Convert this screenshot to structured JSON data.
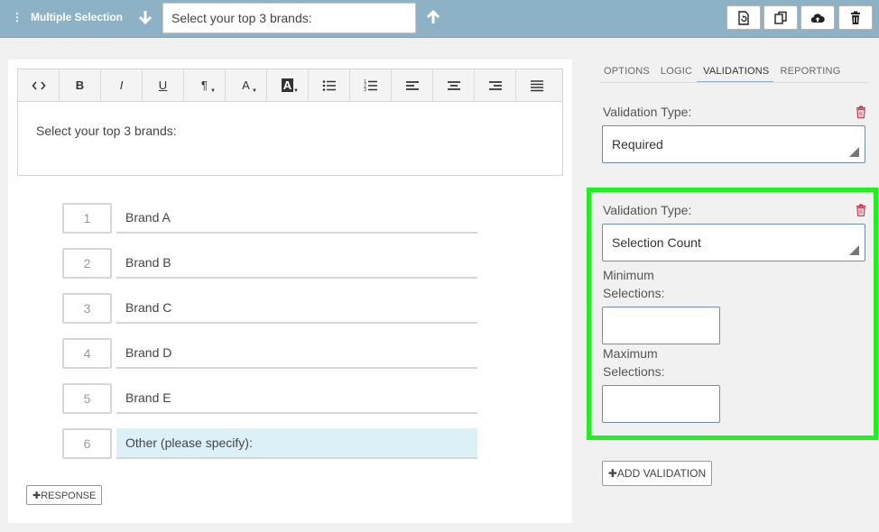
{
  "header": {
    "question_type": "Multiple Selection",
    "question_text": "Select your top 3 brands:",
    "tools": [
      "page-refresh-icon",
      "copy-icon",
      "cloud-upload-icon",
      "trash-icon"
    ]
  },
  "editor": {
    "toolbar": [
      {
        "name": "code",
        "label": "<>"
      },
      {
        "name": "bold",
        "label": "B"
      },
      {
        "name": "italic",
        "label": "I"
      },
      {
        "name": "underline",
        "label": "U"
      },
      {
        "name": "paragraph",
        "label": "¶"
      },
      {
        "name": "font-color",
        "label": "A"
      },
      {
        "name": "background-color",
        "label": "A"
      },
      {
        "name": "bullet-list",
        "label": ""
      },
      {
        "name": "numbered-list",
        "label": ""
      },
      {
        "name": "align-left",
        "label": ""
      },
      {
        "name": "align-center",
        "label": ""
      },
      {
        "name": "align-right",
        "label": ""
      },
      {
        "name": "justify",
        "label": ""
      }
    ],
    "content": "Select your top 3 brands:"
  },
  "responses": [
    {
      "num": "1",
      "label": "Brand A"
    },
    {
      "num": "2",
      "label": "Brand B"
    },
    {
      "num": "3",
      "label": "Brand C"
    },
    {
      "num": "4",
      "label": "Brand D"
    },
    {
      "num": "5",
      "label": "Brand E"
    },
    {
      "num": "6",
      "label": "Other (please specify):"
    }
  ],
  "add_response_label": "✚RESPONSE",
  "tabs": [
    {
      "label": "OPTIONS",
      "active": false
    },
    {
      "label": "LOGIC",
      "active": false
    },
    {
      "label": "VALIDATIONS",
      "active": true
    },
    {
      "label": "REPORTING",
      "active": false
    }
  ],
  "validations": [
    {
      "type_label": "Validation Type:",
      "value": "Required"
    },
    {
      "type_label": "Validation Type:",
      "value": "Selection Count",
      "min_label_1": "Minimum",
      "min_label_2": "Selections:",
      "max_label_1": "Maximum",
      "max_label_2": "Selections:",
      "min_value": "",
      "max_value": ""
    }
  ],
  "add_validation_label": "✚ADD VALIDATION",
  "colors": {
    "topbar": "#8db2c5",
    "highlight_box": "#22ee22",
    "trash": "#cc3355",
    "other_row": "#dcf0f8"
  }
}
